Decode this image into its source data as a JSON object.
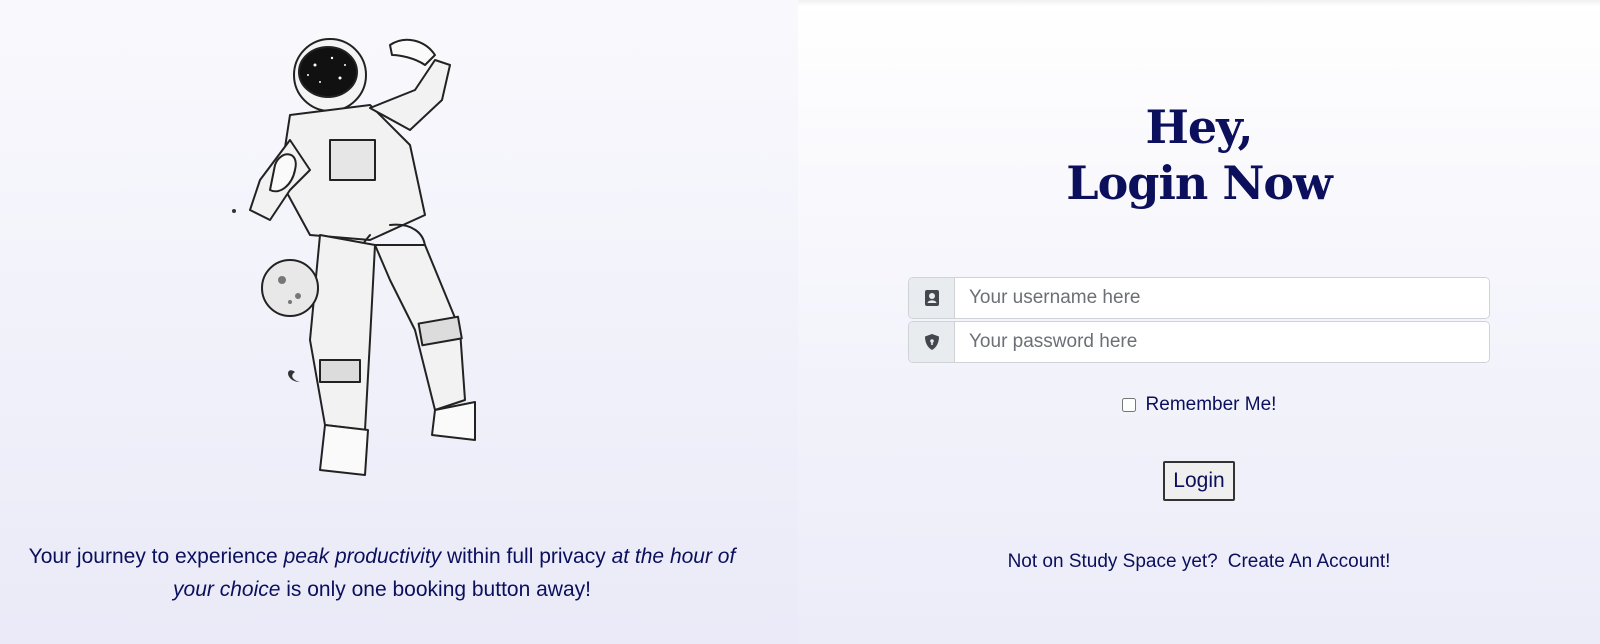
{
  "hero": {
    "image_name": "astronaut-illustration",
    "tagline_part1": "Your journey to experience ",
    "tagline_em1": "peak productivity",
    "tagline_part2": " within full privacy ",
    "tagline_em2": "at the hour of your choice",
    "tagline_part3": " is only one booking button away!"
  },
  "login": {
    "heading_line1": "Hey,",
    "heading_line2": "Login Now",
    "username_placeholder": "Your username here",
    "password_placeholder": "Your password here",
    "remember_label": "Remember Me!",
    "remember_checked": false,
    "submit_label": "Login",
    "signup_prompt": "Not on Study Space yet?",
    "signup_link": "Create An Account!"
  },
  "icons": {
    "username": "contact-card-icon",
    "password": "shield-icon"
  },
  "colors": {
    "primary_text": "#0b0f5c",
    "addon_bg": "#e9ecef"
  }
}
